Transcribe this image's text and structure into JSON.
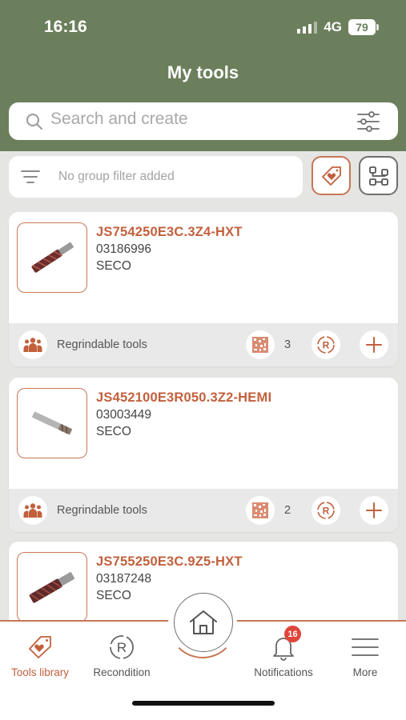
{
  "status": {
    "time": "16:16",
    "network": "4G",
    "battery": "79"
  },
  "header": {
    "title": "My tools"
  },
  "search": {
    "placeholder": "Search and create"
  },
  "filter": {
    "text": "No group filter added"
  },
  "tools": [
    {
      "name": "JS754250E3C.3Z4-HXT",
      "code": "03186996",
      "brand": "SECO",
      "group": "Regrindable tools",
      "count": "3"
    },
    {
      "name": "JS452100E3R050.3Z2-HEMI",
      "code": "03003449",
      "brand": "SECO",
      "group": "Regrindable tools",
      "count": "2"
    },
    {
      "name": "JS755250E3C.9Z5-HXT",
      "code": "03187248",
      "brand": "SECO"
    }
  ],
  "nav": {
    "tools_library": "Tools library",
    "recondition": "Recondition",
    "notifications": "Notifications",
    "notifications_badge": "16",
    "more": "More"
  },
  "colors": {
    "header": "#6c7f5c",
    "accent": "#c2603c",
    "badge": "#e0453a"
  }
}
